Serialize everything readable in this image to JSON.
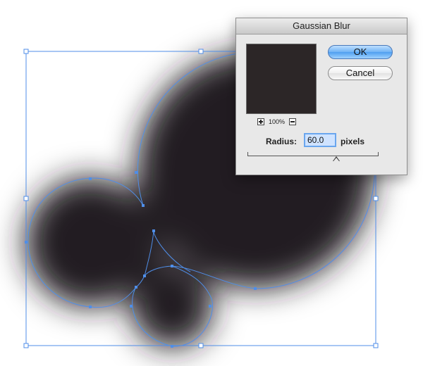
{
  "dialog": {
    "title": "Gaussian Blur",
    "zoom": "100%",
    "ok_label": "OK",
    "cancel_label": "Cancel",
    "radius_label": "Radius:",
    "radius_value": "60.0",
    "units": "pixels",
    "slider_fraction": 0.68
  },
  "colors": {
    "shape_fill": "#231f20",
    "path_stroke": "#4f8ee8",
    "ok_accent": "#4f9ef0"
  },
  "icons": [
    "zoom-in-icon",
    "zoom-out-icon",
    "slider-thumb-icon"
  ]
}
